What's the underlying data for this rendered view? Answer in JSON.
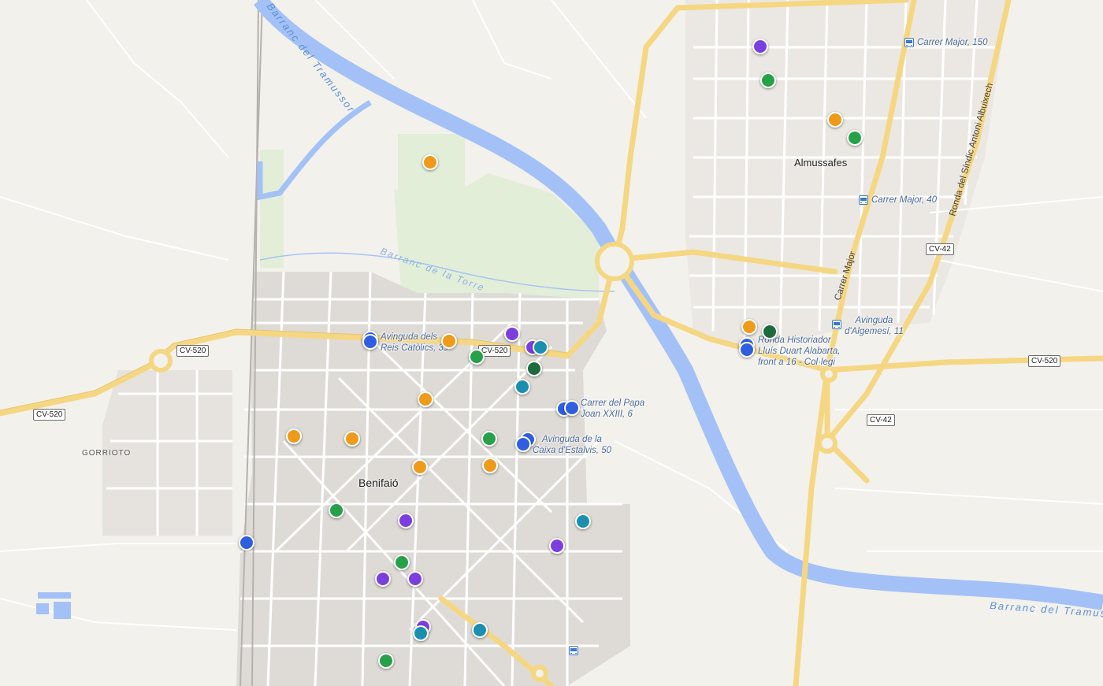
{
  "map": {
    "place_labels": {
      "almussafes": "Almussafes",
      "benifaio": "Benifaió",
      "gorrioto": "GORRIOTO"
    },
    "road_shields": {
      "cv520_west": "CV-520",
      "cv520_west2": "CV-520",
      "cv520_center": "CV-520",
      "cv520_east": "CV-520",
      "cv42_north": "CV-42",
      "cv42_south": "CV-42"
    },
    "street_labels": {
      "carrer_major_vertical": "Carrer Major",
      "ronda_sindic": "Ronda del Síndic Antoni Albuixech"
    },
    "water_labels": {
      "tramussor_north": "Barranc del Tramussor",
      "torre": "Barranc de la Torre",
      "tramussor_east": "Barranc del Tramussor"
    },
    "poi_labels": {
      "reis_catolics": "Avinguda dels\nReis Catòlics, 39",
      "papa_joan": "Carrer del Papa\nJoan XXIII, 6",
      "caixa_estalvis": "Avinguda de la\nCaixa d'Estalvis, 50",
      "major_150": "Carrer Major, 150",
      "major_40": "Carrer Major, 40",
      "algemesi": "Avinguda\nd'Algemesí, 11",
      "ronda_historiador": "Ronda Historiador\nLluís Duart Alabarta,\nfront a 16 - Col·legi"
    },
    "marker_colors": {
      "blue": "#2f5fe0",
      "purple": "#7b3fe0",
      "green": "#27a04a",
      "dark_green": "#1d6b3c",
      "orange": "#f09a1a",
      "teal": "#1b8fae"
    },
    "markers": [
      {
        "name": "marker-blue",
        "color": "blue"
      },
      {
        "name": "marker-blue",
        "color": "blue"
      },
      {
        "name": "marker-blue",
        "color": "blue"
      },
      {
        "name": "marker-blue",
        "color": "blue"
      },
      {
        "name": "marker-blue",
        "color": "blue"
      },
      {
        "name": "marker-blue",
        "color": "blue"
      },
      {
        "name": "marker-blue",
        "color": "blue"
      },
      {
        "name": "marker-purple",
        "color": "purple"
      },
      {
        "name": "marker-purple",
        "color": "purple"
      },
      {
        "name": "marker-purple",
        "color": "purple"
      },
      {
        "name": "marker-purple",
        "color": "purple"
      },
      {
        "name": "marker-purple",
        "color": "purple"
      },
      {
        "name": "marker-purple",
        "color": "purple"
      },
      {
        "name": "marker-purple",
        "color": "purple"
      },
      {
        "name": "marker-purple",
        "color": "purple"
      },
      {
        "name": "marker-green",
        "color": "green"
      },
      {
        "name": "marker-green",
        "color": "green"
      },
      {
        "name": "marker-green",
        "color": "green"
      },
      {
        "name": "marker-green",
        "color": "green"
      },
      {
        "name": "marker-green",
        "color": "green"
      },
      {
        "name": "marker-green",
        "color": "green"
      },
      {
        "name": "marker-green",
        "color": "green"
      },
      {
        "name": "marker-dark-green",
        "color": "dark_green"
      },
      {
        "name": "marker-dark-green",
        "color": "dark_green"
      },
      {
        "name": "marker-orange",
        "color": "orange"
      },
      {
        "name": "marker-orange",
        "color": "orange"
      },
      {
        "name": "marker-orange",
        "color": "orange"
      },
      {
        "name": "marker-orange",
        "color": "orange"
      },
      {
        "name": "marker-orange",
        "color": "orange"
      },
      {
        "name": "marker-orange",
        "color": "orange"
      },
      {
        "name": "marker-orange",
        "color": "orange"
      },
      {
        "name": "marker-orange",
        "color": "orange"
      },
      {
        "name": "marker-orange",
        "color": "orange"
      },
      {
        "name": "marker-teal",
        "color": "teal"
      },
      {
        "name": "marker-teal",
        "color": "teal"
      },
      {
        "name": "marker-teal",
        "color": "teal"
      },
      {
        "name": "marker-teal",
        "color": "teal"
      },
      {
        "name": "marker-teal",
        "color": "teal"
      }
    ],
    "icons": [
      "bus-stop-icon"
    ]
  }
}
